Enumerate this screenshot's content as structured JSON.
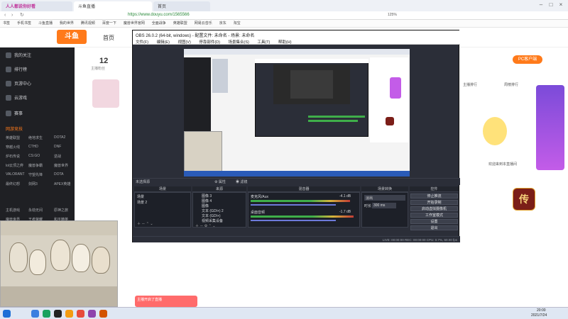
{
  "browser": {
    "tabs": [
      {
        "label": "人人都说你好看",
        "active": false
      },
      {
        "label": "斗鱼直播",
        "active": true
      },
      {
        "label": "首页",
        "active": false
      }
    ],
    "address": "https://www.douyu.com/1565566",
    "zoom": "125%",
    "bookmarks": [
      "书签",
      "手机书签",
      "斗鱼直播",
      "我的世界",
      "腾讯视频",
      "百度一下",
      "魔兽世界官网",
      "全面战争",
      "英雄联盟",
      "网易云音乐",
      "京东",
      "淘宝"
    ]
  },
  "douyu": {
    "nav_home": "首页",
    "follow_count": "12",
    "follow_label": "主播粉丝",
    "pc_client": "PC客户端",
    "rank_label": "主播排行",
    "weekly_rank": "周榜排行",
    "welcome": "欢迎来到本直播间",
    "sidebar": {
      "items": [
        "我的关注",
        "排行榜",
        "页游中心",
        "云游戏",
        "赛事"
      ],
      "section": "网游竞技",
      "games": [
        [
          "英雄联盟",
          "绝地求生",
          "DOTA2"
        ],
        [
          "穿越火线",
          "CTHD",
          "DNF"
        ],
        [
          "炉石传说",
          "CS:GO",
          "逆战"
        ],
        [
          "lol云顶之弈",
          "魔兽争霸",
          "魔兽世界"
        ],
        [
          "VALORANT",
          "守望先锋",
          "DOTA"
        ],
        [
          "最终幻想",
          "剑网3",
          "APEX英雄"
        ]
      ],
      "extra": [
        [
          "主机游戏",
          "永劫无间",
          "原神之旅"
        ],
        [
          "魔兽世界",
          "王者荣耀",
          "和平精英"
        ]
      ]
    }
  },
  "obs": {
    "title": "OBS 26.0.2 (64-bit, windows) - 配置文件: 未命名 - 场景: 未命名",
    "menu": [
      "文件(F)",
      "编辑(E)",
      "视图(V)",
      "停靠部件(D)",
      "场景集合(S)",
      "工具(T)",
      "帮助(H)"
    ],
    "toolbar_label": "未选择源",
    "props": "属性",
    "filters": "滤镜",
    "panels": {
      "scenes": "场景",
      "sources": "来源",
      "mixer": "混音器",
      "transitions": "场景转换",
      "controls": "控件"
    },
    "scenes": [
      "场景",
      "场景 2"
    ],
    "sources": [
      "图像 3",
      "图像 4",
      "图像",
      "文本 (GDI+) 2",
      "文本 (GDI+)",
      "视频采集设备"
    ],
    "mixer": [
      {
        "name": "麦克风/Aux",
        "db": "-4.1 dB"
      },
      {
        "name": "桌面音频",
        "db": "-1.7 dB"
      }
    ],
    "transition_type": "淡出",
    "duration_label": "时长",
    "duration_value": "300 ms",
    "controls": [
      "停止推流",
      "开始录制",
      "启动虚拟摄像机",
      "工作室模式",
      "设置",
      "退出"
    ],
    "status": "LIVE: 00:00:00    REC: 00:00:00    CPU: 0.7%, 60.00 fps"
  },
  "notification": "主播开启了直播",
  "clock": {
    "time": "20:00",
    "date": "2021/7/24"
  },
  "colors": {
    "accent": "#ff7a1a",
    "obs_bg": "#2b2e38",
    "sidebar": "#1f2024"
  }
}
